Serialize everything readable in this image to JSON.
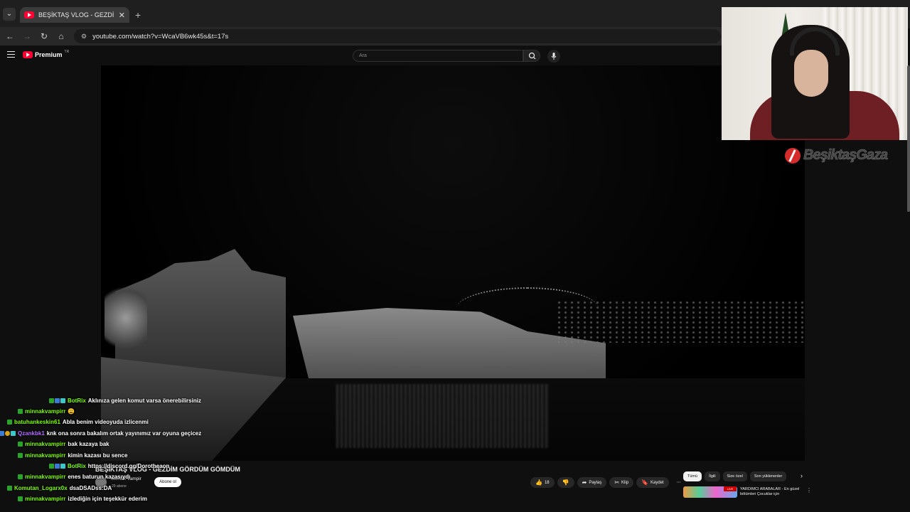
{
  "browser": {
    "tab_title": "BEŞİKTAŞ VLOG - GEZDİM GÖR",
    "url": "youtube.com/watch?v=WcaVB6wk45s&t=17s"
  },
  "youtube": {
    "logo_text": "Premium",
    "logo_sup": "TR",
    "search_placeholder": "Ara"
  },
  "video": {
    "title": "BEŞİKTAŞ VLOG - GEZDİM GÖRDÜM GÖMDÜM",
    "channel": "Minnak Vampir",
    "subscribers": "29 abone",
    "subscribe_label": "Abone ol",
    "actions": [
      {
        "icon": "thumb-up-icon",
        "label": "18"
      },
      {
        "icon": "thumb-down-icon",
        "label": ""
      },
      {
        "icon": "share-icon",
        "label": "Paylaş"
      },
      {
        "icon": "clip-icon",
        "label": "Klip"
      },
      {
        "icon": "save-icon",
        "label": "Kaydet"
      },
      {
        "icon": "more-icon",
        "label": "⋯"
      }
    ]
  },
  "side": {
    "chips": [
      "Tümü",
      "İlgili",
      "Size özel",
      "Son yüklenenler"
    ],
    "recommendation": {
      "live_badge": "LIVE",
      "title": "YARDIMCI ARABALAR - En güzel bölümleri Çocuklar için"
    }
  },
  "watermark": {
    "text": "BeşiktaşGaza"
  },
  "chat": [
    {
      "badges": [
        "b-green",
        "b-blue",
        "b-cyan"
      ],
      "user": "BotRix",
      "color": "#7fff00",
      "msg": "Aklınıza gelen komut varsa önerebilirsiniz"
    },
    {
      "badges": [
        "b-green"
      ],
      "user": "minnakvampirr",
      "color": "#7fff00",
      "msg": "😩"
    },
    {
      "badges": [
        "b-green"
      ],
      "user": "batuhankeskin61",
      "color": "#7fff00",
      "msg": "Abla benim videoyuda izlicenmi"
    },
    {
      "badges": [
        "b-green",
        "b-blue",
        "b-gold",
        "b-cyan"
      ],
      "user": "Qzankbk1",
      "color": "#b36bff",
      "msg": "knk ona sonra bakalım ortak yayınımız var oyuna geçicez"
    },
    {
      "badges": [
        "b-green"
      ],
      "user": "minnakvampirr",
      "color": "#7fff00",
      "msg": "bak kazaya bak"
    },
    {
      "badges": [
        "b-green"
      ],
      "user": "minnakvampirr",
      "color": "#7fff00",
      "msg": "kimin kazası bu sence"
    },
    {
      "badges": [
        "b-green",
        "b-blue",
        "b-cyan"
      ],
      "user": "BotRix",
      "color": "#7fff00",
      "msg": "https://discord.gg/Dorotheaon"
    },
    {
      "badges": [
        "b-green"
      ],
      "user": "minnakvampirr",
      "color": "#7fff00",
      "msg": "enes baturun kazasıydı"
    },
    {
      "badges": [
        "b-green"
      ],
      "user": "Komutan_Logarx0x",
      "color": "#7fff00",
      "msg": "dsaDSADss:DA"
    },
    {
      "badges": [
        "b-green"
      ],
      "user": "minnakvampirr",
      "color": "#7fff00",
      "msg": "izlediğin için teşekkür ederim"
    }
  ]
}
